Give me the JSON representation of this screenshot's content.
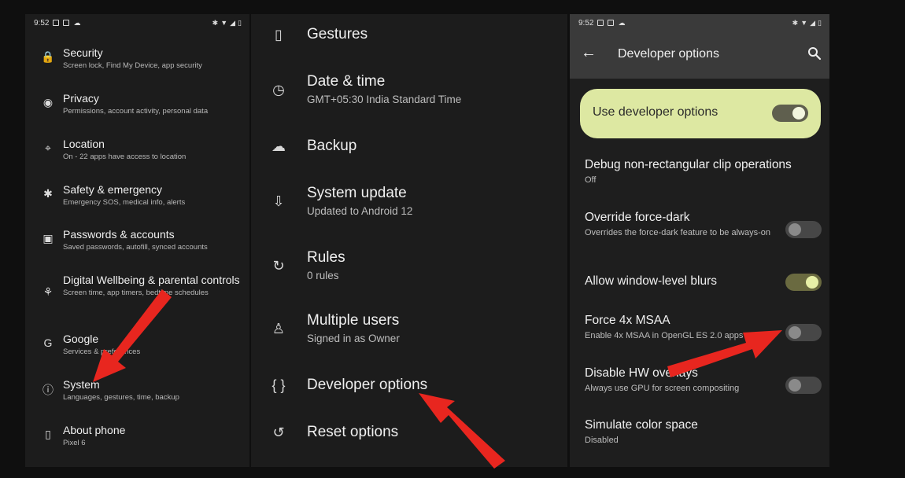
{
  "status": {
    "time": "9:52"
  },
  "left": {
    "items": [
      {
        "icon": "lock-icon",
        "glyph": "🔒",
        "title": "Security",
        "subtitle": "Screen lock, Find My Device, app security"
      },
      {
        "icon": "privacy-icon",
        "glyph": "◉",
        "title": "Privacy",
        "subtitle": "Permissions, account activity, personal data"
      },
      {
        "icon": "location-icon",
        "glyph": "⌖",
        "title": "Location",
        "subtitle": "On - 22 apps have access to location"
      },
      {
        "icon": "asterisk-icon",
        "glyph": "✱",
        "title": "Safety & emergency",
        "subtitle": "Emergency SOS, medical info, alerts"
      },
      {
        "icon": "accounts-icon",
        "glyph": "▣",
        "title": "Passwords & accounts",
        "subtitle": "Saved passwords, autofill, synced accounts"
      },
      {
        "icon": "wellbeing-icon",
        "glyph": "⚘",
        "title": "Digital Wellbeing & parental controls",
        "subtitle": "Screen time, app timers, bedtime schedules"
      },
      {
        "icon": "google-icon",
        "glyph": "G",
        "title": "Google",
        "subtitle": "Services & preferences"
      },
      {
        "icon": "info-icon",
        "glyph": "ⓘ",
        "title": "System",
        "subtitle": "Languages, gestures, time, backup"
      },
      {
        "icon": "phone-icon",
        "glyph": "▯",
        "title": "About phone",
        "subtitle": "Pixel 6"
      }
    ]
  },
  "middle": {
    "items": [
      {
        "icon": "gestures-icon",
        "glyph": "▯",
        "title": "Gestures",
        "subtitle": ""
      },
      {
        "icon": "clock-icon",
        "glyph": "◷",
        "title": "Date & time",
        "subtitle": "GMT+05:30 India Standard Time"
      },
      {
        "icon": "cloud-upload-icon",
        "glyph": "☁",
        "title": "Backup",
        "subtitle": ""
      },
      {
        "icon": "system-update-icon",
        "glyph": "⇩",
        "title": "System update",
        "subtitle": "Updated to Android 12"
      },
      {
        "icon": "rules-icon",
        "glyph": "↻",
        "title": "Rules",
        "subtitle": "0 rules"
      },
      {
        "icon": "person-icon",
        "glyph": "♙",
        "title": "Multiple users",
        "subtitle": "Signed in as Owner"
      },
      {
        "icon": "code-braces-icon",
        "glyph": "{ }",
        "title": "Developer options",
        "subtitle": ""
      },
      {
        "icon": "history-icon",
        "glyph": "↺",
        "title": "Reset options",
        "subtitle": ""
      }
    ]
  },
  "right": {
    "title": "Developer options",
    "master_toggle_label": "Use developer options",
    "master_toggle_on": true,
    "items": [
      {
        "title": "Debug non-rectangular clip operations",
        "subtitle": "Off",
        "toggle": null
      },
      {
        "title": "Override force-dark",
        "subtitle": "Overrides the force-dark feature to be always-on",
        "toggle": "off"
      },
      {
        "title": "Allow window-level blurs",
        "subtitle": "",
        "toggle": "on"
      },
      {
        "title": "Force 4x MSAA",
        "subtitle": "Enable 4x MSAA in OpenGL ES 2.0 apps",
        "toggle": "off"
      },
      {
        "title": "Disable HW overlays",
        "subtitle": "Always use GPU for screen compositing",
        "toggle": "off"
      },
      {
        "title": "Simulate color space",
        "subtitle": "Disabled",
        "toggle": null
      }
    ]
  },
  "colors": {
    "accent_card": "#dde8a2",
    "arrow": "#e8261f",
    "panel_bg": "#1c1c1c",
    "toolbar_bg": "#3a3a3a"
  }
}
